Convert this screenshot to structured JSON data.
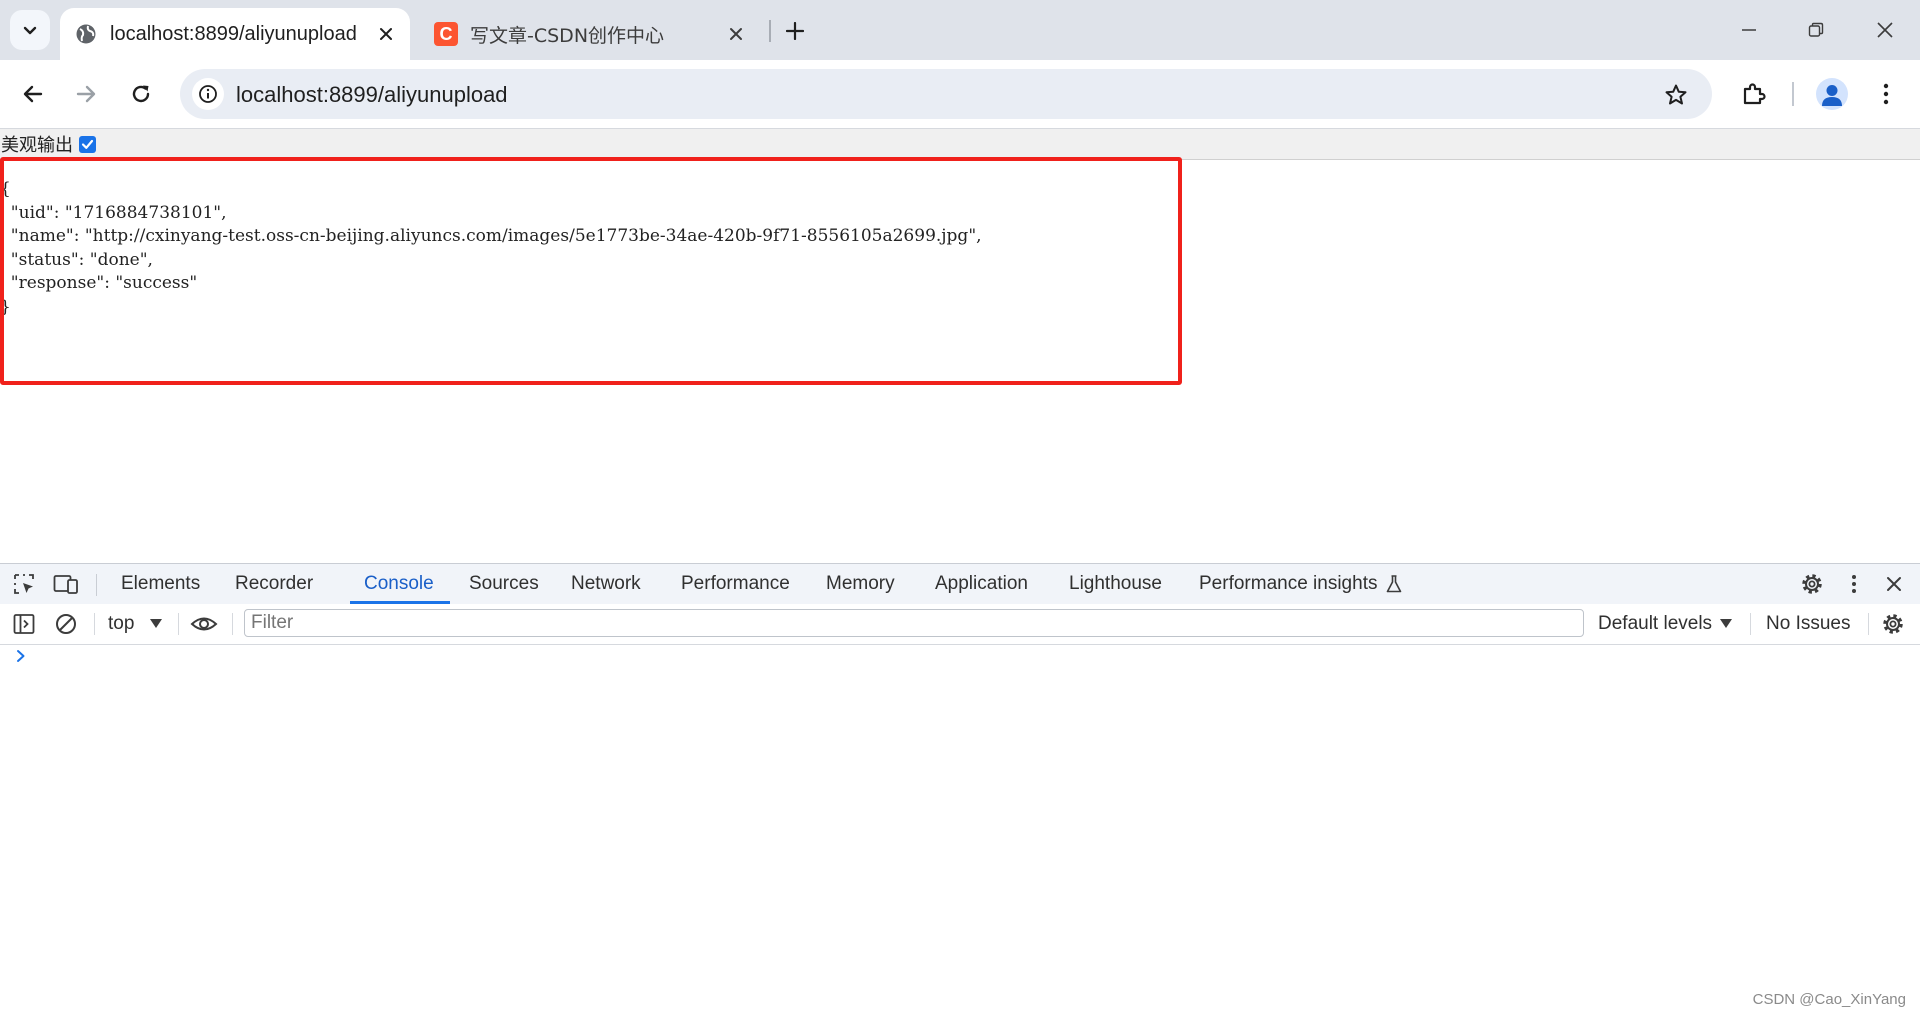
{
  "browser": {
    "tabs": [
      {
        "title": "localhost:8899/aliyunupload",
        "active": true,
        "favicon": "globe-icon"
      },
      {
        "title": "写文章-CSDN创作中心",
        "active": false,
        "favicon": "csdn-logo",
        "favicon_letter": "C"
      }
    ],
    "url": "localhost:8899/aliyunupload"
  },
  "page": {
    "pretty_print_label": "美观输出",
    "pretty_print_checked": true,
    "json_lines": [
      "{",
      "  \"uid\": \"1716884738101\",",
      "  \"name\": \"http://cxinyang-test.oss-cn-beijing.aliyuncs.com/images/5e1773be-34ae-420b-9f71-8556105a2699.jpg\",",
      "  \"status\": \"done\",",
      "  \"response\": \"success\"",
      "}"
    ],
    "highlight_color": "#f0211b"
  },
  "devtools": {
    "tabs": [
      "Elements",
      "Recorder",
      "Console",
      "Sources",
      "Network",
      "Performance",
      "Memory",
      "Application",
      "Lighthouse",
      "Performance insights"
    ],
    "active_tab": "Console",
    "console": {
      "context": "top",
      "filter_placeholder": "Filter",
      "levels": "Default levels",
      "issues": "No Issues"
    }
  },
  "watermark": "CSDN @Cao_XinYang",
  "colors": {
    "accent": "#1a73e8",
    "titlebar": "#dfe3ea",
    "highlight": "#f0211b"
  }
}
